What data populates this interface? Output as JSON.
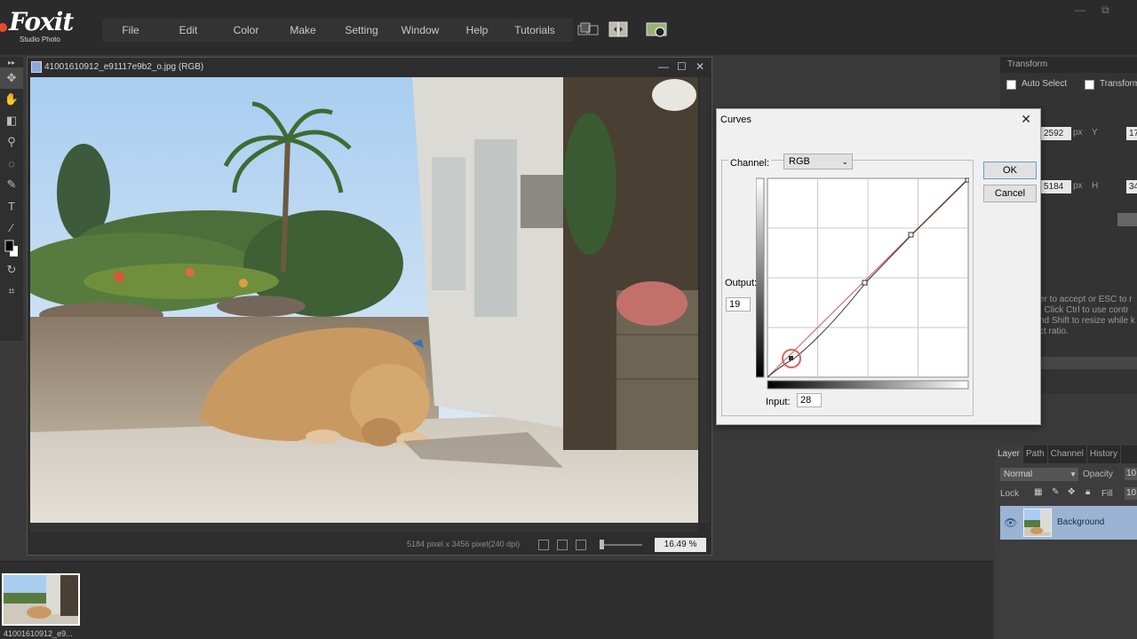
{
  "app": {
    "logo_text": "Foxit",
    "logo_sub": "Studio Photo",
    "window_controls": [
      "—",
      "⧉"
    ]
  },
  "menu": {
    "items": [
      "File",
      "Edit",
      "Color",
      "Make",
      "Setting",
      "Window",
      "Help",
      "Tutorials"
    ]
  },
  "tool_icons": [
    "layers-icon",
    "compare-icon",
    "screenshot-icon"
  ],
  "left_tools": [
    "move-tool-icon",
    "hand-tool-icon",
    "eraser-tool-icon",
    "stamp-tool-icon",
    "lasso-tool-icon",
    "brush-tool-icon",
    "text-tool-icon",
    "eyedropper-tool-icon",
    "color-swatch-icon",
    "rotate-tool-icon",
    "crop-tool-icon"
  ],
  "document": {
    "title": "41001610912_e91117e9b2_o.jpg (RGB)",
    "dimensions": "5184 pixel x 3456 pixel(240 dpi)",
    "zoom": "16.49 %",
    "controls": [
      "—",
      "☐",
      "✕"
    ]
  },
  "curves": {
    "title": "Curves",
    "close": "✕",
    "channel_label": "Channel:",
    "channel_value": "RGB",
    "ok_label": "OK",
    "cancel_label": "Cancel",
    "output_label": "Output:",
    "output_value": "19",
    "input_label": "Input:",
    "input_value": "28"
  },
  "transform": {
    "title": "Transform",
    "auto_select": "Auto Select",
    "transform_label": "Transform",
    "x_value": "2592",
    "y_label": "Y",
    "y_value": "17",
    "w_value": "5184",
    "h_label": "H",
    "h_value": "34",
    "unit": "px",
    "hint_lines": [
      "er to accept or ESC to r",
      ". Click Ctrl to use contr",
      "hd Shift to resize while k",
      "ct ratio."
    ]
  },
  "layers": {
    "tabs": [
      "Layer",
      "Path",
      "Channel",
      "History"
    ],
    "blend_mode": "Normal",
    "opacity_label": "Opacity",
    "opacity_value": "10",
    "lock_label": "Lock",
    "fill_label": "Fill",
    "fill_value": "10",
    "layer_name": "Background"
  },
  "filmstrip": {
    "label": "41001610912_e9..."
  },
  "colors": {
    "accent": "#e34b2a",
    "selection": "#9bb4d4",
    "curve": "#c84444"
  }
}
